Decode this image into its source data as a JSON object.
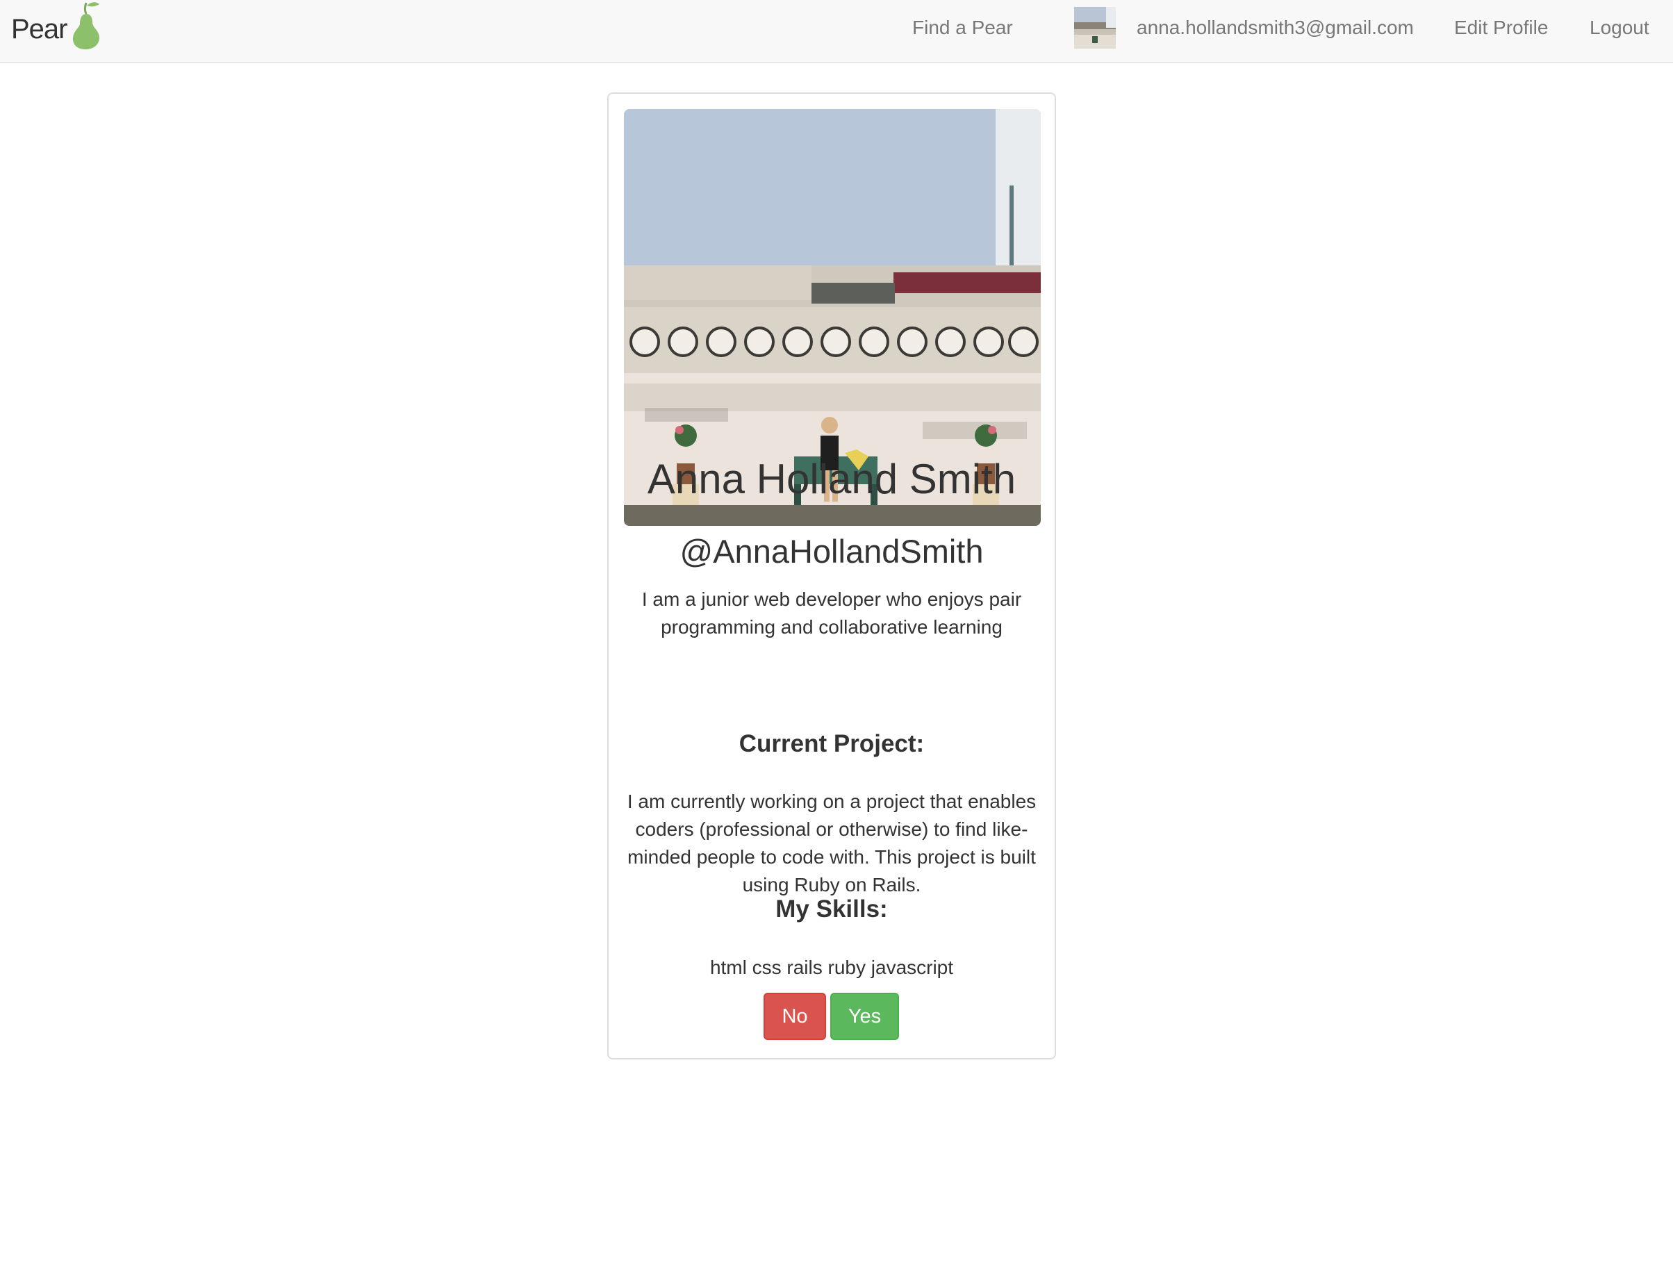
{
  "navbar": {
    "brand": "Pear",
    "links": {
      "find": "Find a Pear",
      "email": "anna.hollandsmith3@gmail.com",
      "edit": "Edit Profile",
      "logout": "Logout"
    },
    "avatar_icon": "user-avatar-thumbnail"
  },
  "profile": {
    "full_name": "Anna Holland Smith",
    "username": "@AnnaHollandSmith",
    "bio": "I am a junior web developer who enjoys pair programming and collaborative learning",
    "project_heading": "Current Project:",
    "project_text": "I am currently working on a project that enables coders (professional or otherwise) to find like-minded people to code with. This project is built using Ruby on Rails.",
    "skills_heading": "My Skills:",
    "skills": "html css rails ruby javascript",
    "photo_icon": "profile-photo"
  },
  "actions": {
    "no": "No",
    "yes": "Yes"
  },
  "colors": {
    "brand_green": "#8cc06b",
    "no_button": "#d9534f",
    "yes_button": "#5cb85c",
    "navbar_bg": "#f8f8f8"
  }
}
